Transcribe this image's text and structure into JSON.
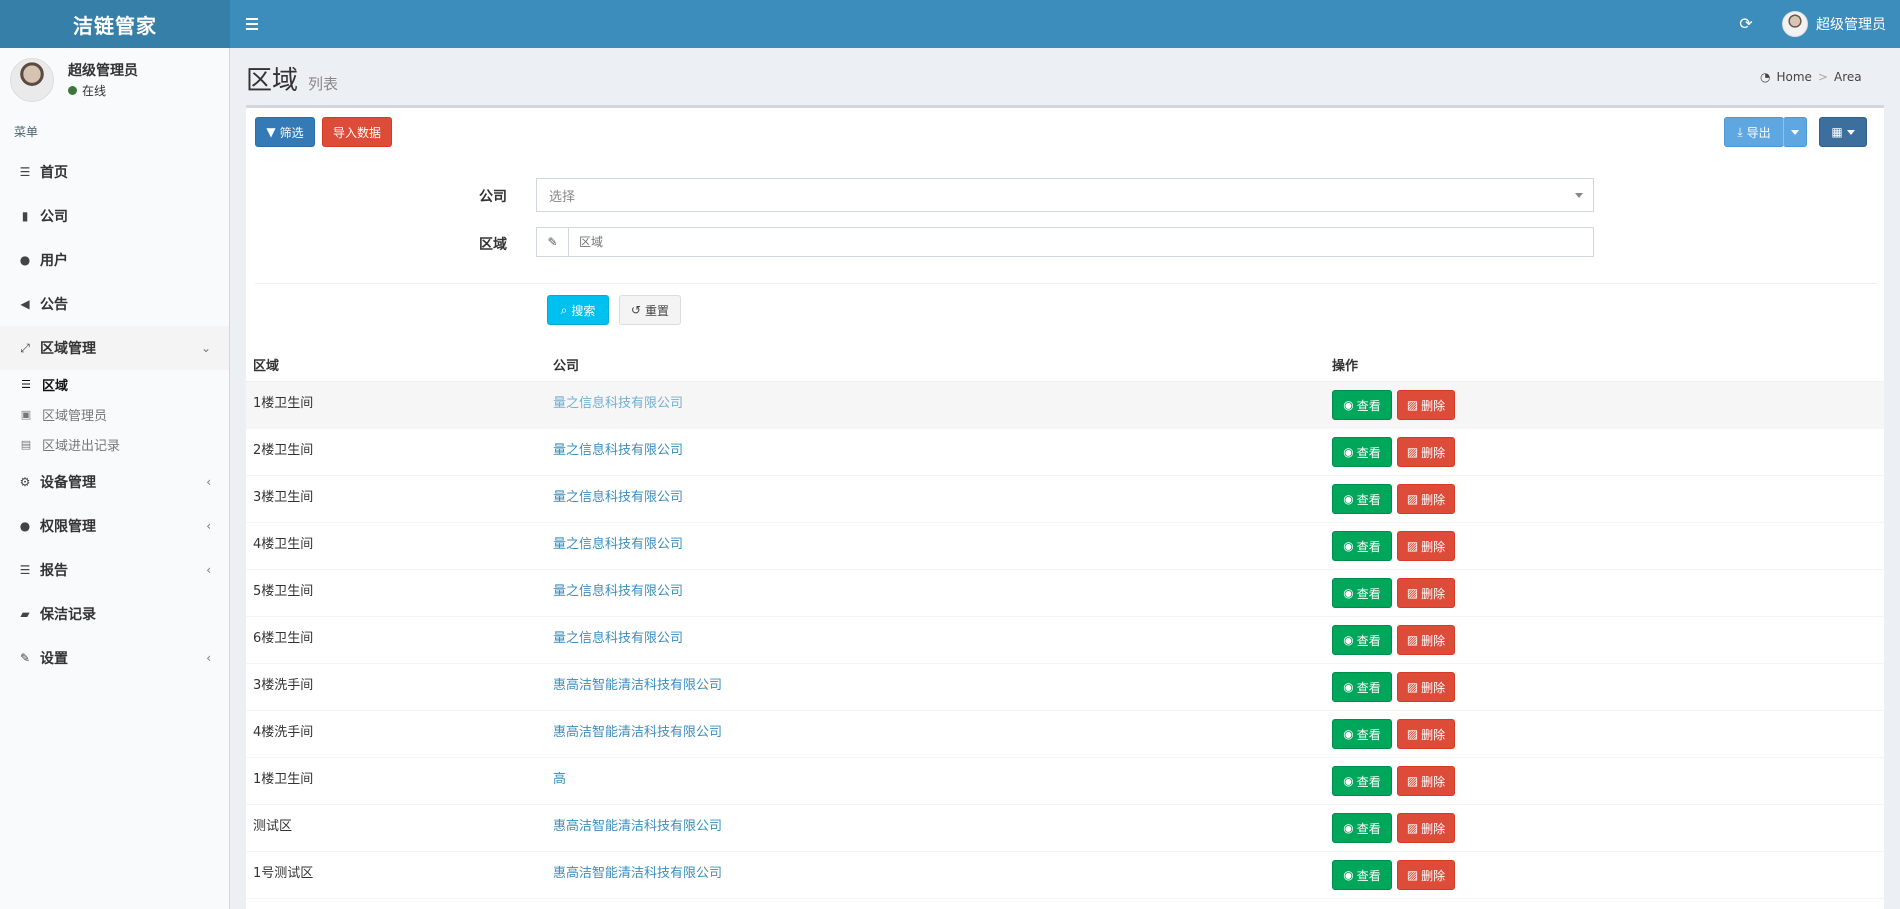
{
  "app": {
    "title": "洁链管家"
  },
  "header": {
    "user_name": "超级管理员"
  },
  "sidebar": {
    "user": {
      "name": "超级管理员",
      "status": "在线"
    },
    "menu_header": "菜单",
    "items": [
      {
        "label": "首页",
        "icon": "list-icon"
      },
      {
        "label": "公司",
        "icon": "building-icon"
      },
      {
        "label": "用户",
        "icon": "user-icon"
      },
      {
        "label": "公告",
        "icon": "bullhorn-icon"
      },
      {
        "label": "区域管理",
        "icon": "expand-icon"
      },
      {
        "label": "设备管理",
        "icon": "cogs-icon"
      },
      {
        "label": "权限管理",
        "icon": "users-icon"
      },
      {
        "label": "报告",
        "icon": "bars-icon"
      },
      {
        "label": "保洁记录",
        "icon": "book-icon"
      },
      {
        "label": "设置",
        "icon": "wrench-icon"
      }
    ],
    "sub_items": [
      {
        "label": "区域",
        "icon": "bars-icon"
      },
      {
        "label": "区域管理员",
        "icon": "archive-icon"
      },
      {
        "label": "区域进出记录",
        "icon": "file-icon"
      }
    ]
  },
  "page": {
    "title": "区域",
    "subtitle": "列表"
  },
  "breadcrumb": {
    "home": "Home",
    "current": "Area"
  },
  "toolbar": {
    "filter": "筛选",
    "import": "导入数据",
    "export": "导出"
  },
  "filters": {
    "company_label": "公司",
    "company_placeholder": "选择",
    "area_label": "区域",
    "area_placeholder": "区域",
    "search": "搜索",
    "reset": "重置"
  },
  "table": {
    "headers": [
      "区域",
      "公司",
      "操作"
    ],
    "view_label": "查看",
    "delete_label": "删除",
    "rows": [
      [
        "1楼卫生间",
        "量之信息科技有限公司"
      ],
      [
        "2楼卫生间",
        "量之信息科技有限公司"
      ],
      [
        "3楼卫生间",
        "量之信息科技有限公司"
      ],
      [
        "4楼卫生间",
        "量之信息科技有限公司"
      ],
      [
        "5楼卫生间",
        "量之信息科技有限公司"
      ],
      [
        "6楼卫生间",
        "量之信息科技有限公司"
      ],
      [
        "3楼洗手间",
        "惠高洁智能清洁科技有限公司"
      ],
      [
        "4楼洗手间",
        "惠高洁智能清洁科技有限公司"
      ],
      [
        "1楼卫生间",
        "高"
      ],
      [
        "测试区",
        "惠高洁智能清洁科技有限公司"
      ],
      [
        "1号测试区",
        "惠高洁智能清洁科技有限公司"
      ]
    ]
  },
  "colors": {
    "header": "#3c8dbc",
    "logo_bg": "#367fa9",
    "success": "#00a65a",
    "danger": "#dd4b39",
    "info": "#00c0ef",
    "primary": "#337ab7"
  }
}
